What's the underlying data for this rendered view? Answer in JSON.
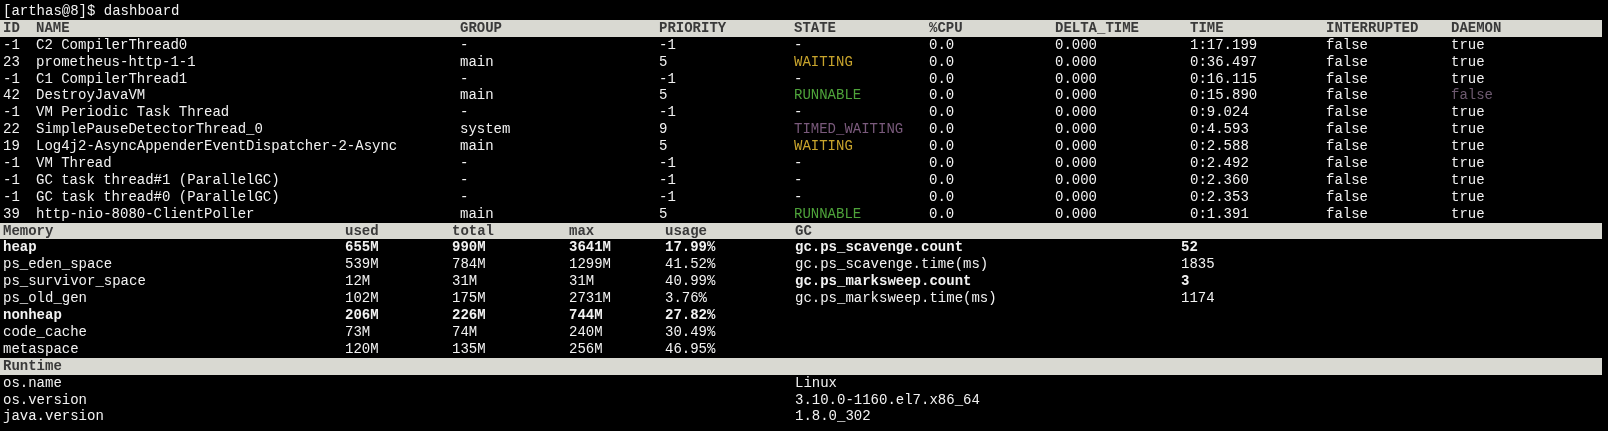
{
  "prompt": "[arthas@8]$ dashboard",
  "threads": {
    "columns": [
      "ID",
      "NAME",
      "GROUP",
      "PRIORITY",
      "STATE",
      "%CPU",
      "DELTA_TIME",
      "TIME",
      "INTERRUPTED",
      "DAEMON"
    ],
    "rows": [
      {
        "id": "-1",
        "name": "C2 CompilerThread0",
        "group": "-",
        "priority": "-1",
        "state": {
          "text": "-"
        },
        "cpu": "0.0",
        "delta_time": "0.000",
        "time": "1:17.199",
        "interrupted": "false",
        "daemon": {
          "text": "true"
        }
      },
      {
        "id": "23",
        "name": "prometheus-http-1-1",
        "group": "main",
        "priority": "5",
        "state": {
          "text": "WAITING",
          "color": "#c8a42c"
        },
        "cpu": "0.0",
        "delta_time": "0.000",
        "time": "0:36.497",
        "interrupted": "false",
        "daemon": {
          "text": "true"
        }
      },
      {
        "id": "-1",
        "name": "C1 CompilerThread1",
        "group": "-",
        "priority": "-1",
        "state": {
          "text": "-"
        },
        "cpu": "0.0",
        "delta_time": "0.000",
        "time": "0:16.115",
        "interrupted": "false",
        "daemon": {
          "text": "true"
        }
      },
      {
        "id": "42",
        "name": "DestroyJavaVM",
        "group": "main",
        "priority": "5",
        "state": {
          "text": "RUNNABLE",
          "color": "#4ea33a"
        },
        "cpu": "0.0",
        "delta_time": "0.000",
        "time": "0:15.890",
        "interrupted": "false",
        "daemon": {
          "text": "false",
          "color": "#6e5a70"
        }
      },
      {
        "id": "-1",
        "name": "VM Periodic Task Thread",
        "group": "-",
        "priority": "-1",
        "state": {
          "text": "-"
        },
        "cpu": "0.0",
        "delta_time": "0.000",
        "time": "0:9.024",
        "interrupted": "false",
        "daemon": {
          "text": "true"
        }
      },
      {
        "id": "22",
        "name": "SimplePauseDetectorThread_0",
        "group": "system",
        "priority": "9",
        "state": {
          "text": "TIMED_WAITING",
          "color": "#7a5a7c"
        },
        "cpu": "0.0",
        "delta_time": "0.000",
        "time": "0:4.593",
        "interrupted": "false",
        "daemon": {
          "text": "true"
        }
      },
      {
        "id": "19",
        "name": "Log4j2-AsyncAppenderEventDispatcher-2-Async",
        "group": "main",
        "priority": "5",
        "state": {
          "text": "WAITING",
          "color": "#c8a42c"
        },
        "cpu": "0.0",
        "delta_time": "0.000",
        "time": "0:2.588",
        "interrupted": "false",
        "daemon": {
          "text": "true"
        }
      },
      {
        "id": "-1",
        "name": "VM Thread",
        "group": "-",
        "priority": "-1",
        "state": {
          "text": "-"
        },
        "cpu": "0.0",
        "delta_time": "0.000",
        "time": "0:2.492",
        "interrupted": "false",
        "daemon": {
          "text": "true"
        }
      },
      {
        "id": "-1",
        "name": "GC task thread#1 (ParallelGC)",
        "group": "-",
        "priority": "-1",
        "state": {
          "text": "-"
        },
        "cpu": "0.0",
        "delta_time": "0.000",
        "time": "0:2.360",
        "interrupted": "false",
        "daemon": {
          "text": "true"
        }
      },
      {
        "id": "-1",
        "name": "GC task thread#0 (ParallelGC)",
        "group": "-",
        "priority": "-1",
        "state": {
          "text": "-"
        },
        "cpu": "0.0",
        "delta_time": "0.000",
        "time": "0:2.353",
        "interrupted": "false",
        "daemon": {
          "text": "true"
        }
      },
      {
        "id": "39",
        "name": "http-nio-8080-ClientPoller",
        "group": "main",
        "priority": "5",
        "state": {
          "text": "RUNNABLE",
          "color": "#4ea33a"
        },
        "cpu": "0.0",
        "delta_time": "0.000",
        "time": "0:1.391",
        "interrupted": "false",
        "daemon": {
          "text": "true"
        }
      }
    ]
  },
  "memory": {
    "columns": [
      "Memory",
      "used",
      "total",
      "max",
      "usage"
    ],
    "rows": [
      {
        "name": "heap",
        "used": "655M",
        "total": "990M",
        "max": "3641M",
        "usage": "17.99%",
        "bold": true
      },
      {
        "name": "ps_eden_space",
        "used": "539M",
        "total": "784M",
        "max": "1299M",
        "usage": "41.52%",
        "bold": false
      },
      {
        "name": "ps_survivor_space",
        "used": "12M",
        "total": "31M",
        "max": "31M",
        "usage": "40.99%",
        "bold": false
      },
      {
        "name": "ps_old_gen",
        "used": "102M",
        "total": "175M",
        "max": "2731M",
        "usage": "3.76%",
        "bold": false
      },
      {
        "name": "nonheap",
        "used": "206M",
        "total": "226M",
        "max": "744M",
        "usage": "27.82%",
        "bold": true
      },
      {
        "name": "code_cache",
        "used": "73M",
        "total": "74M",
        "max": "240M",
        "usage": "30.49%",
        "bold": false
      },
      {
        "name": "metaspace",
        "used": "120M",
        "total": "135M",
        "max": "256M",
        "usage": "46.95%",
        "bold": false
      }
    ]
  },
  "gc": {
    "title": "GC",
    "rows": [
      {
        "name": "gc.ps_scavenge.count",
        "value": "52",
        "bold": true
      },
      {
        "name": "gc.ps_scavenge.time(ms)",
        "value": "1835",
        "bold": false
      },
      {
        "name": "gc.ps_marksweep.count",
        "value": "3",
        "bold": true
      },
      {
        "name": "gc.ps_marksweep.time(ms)",
        "value": "1174",
        "bold": false
      }
    ]
  },
  "runtime": {
    "title": "Runtime",
    "rows": [
      {
        "name": "os.name",
        "value": "Linux"
      },
      {
        "name": "os.version",
        "value": "3.10.0-1160.el7.x86_64"
      },
      {
        "name": "java.version",
        "value": "1.8.0_302"
      }
    ]
  }
}
